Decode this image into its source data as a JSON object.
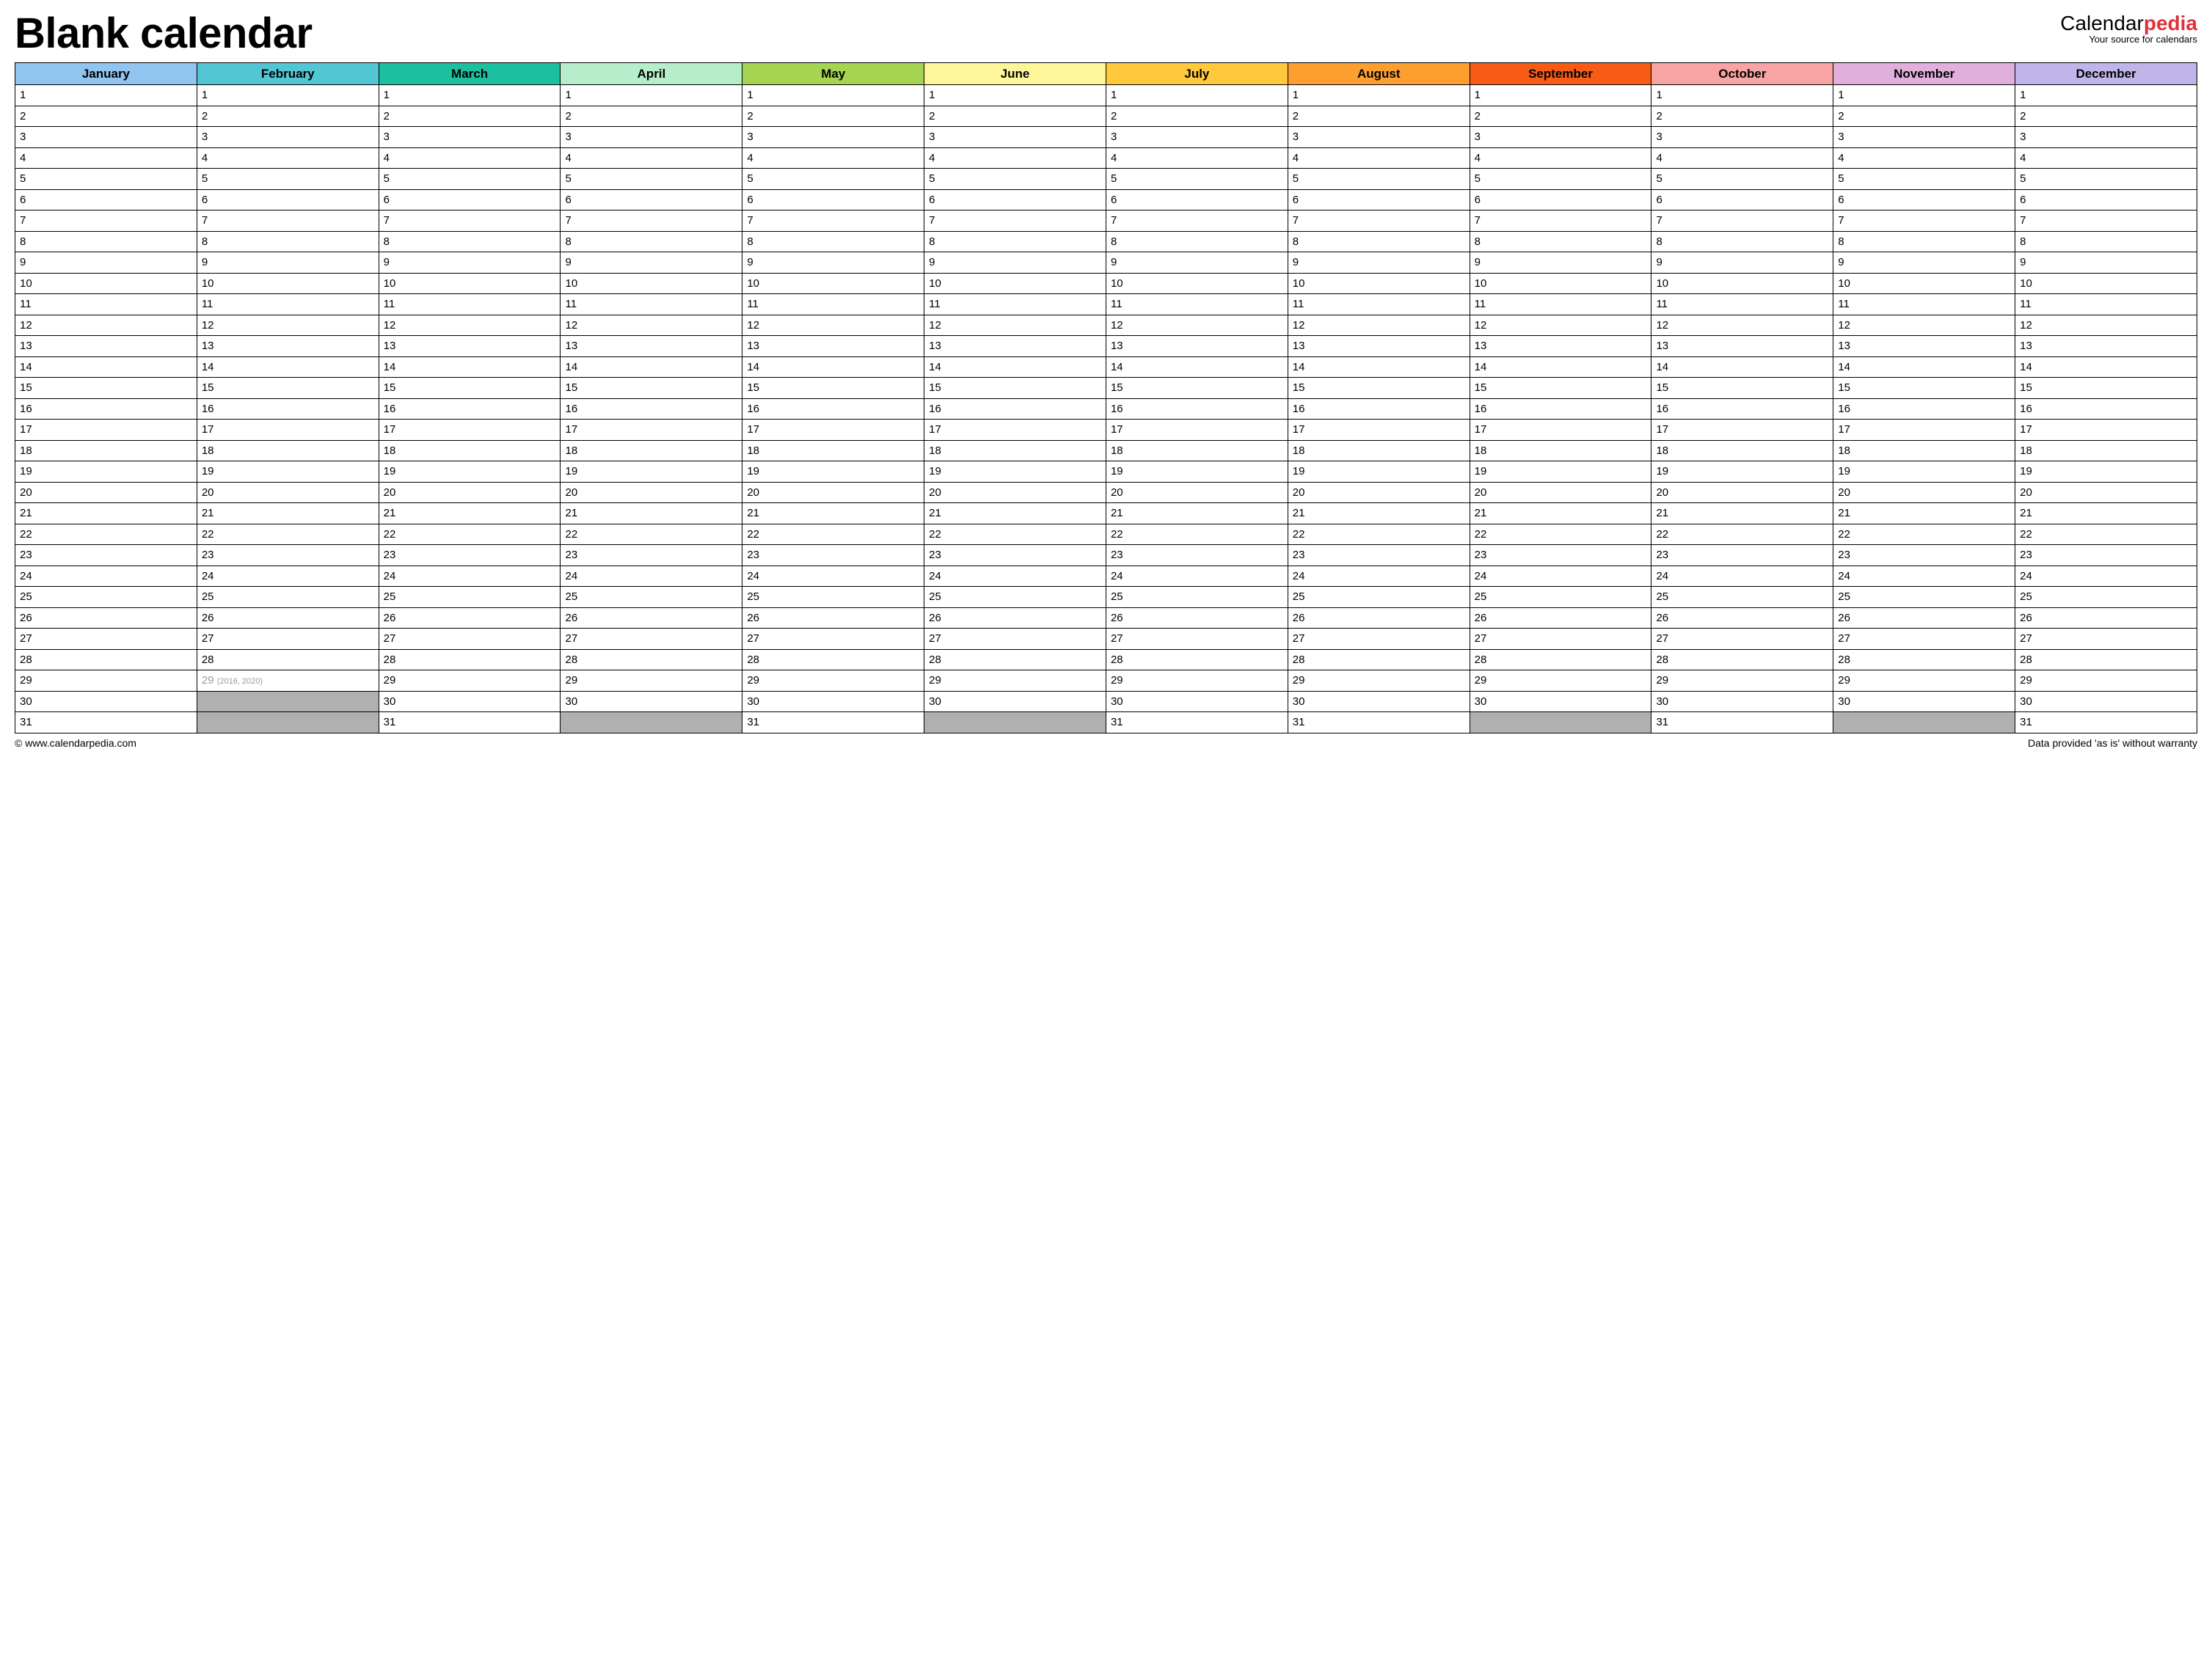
{
  "header": {
    "title": "Blank calendar",
    "brand_cal": "Calendar",
    "brand_pedia": "pedia",
    "brand_sub": "Your source for calendars"
  },
  "months": [
    {
      "name": "January",
      "color": "#92c4f0",
      "days": 31
    },
    {
      "name": "February",
      "color": "#53c6d3",
      "days": 28,
      "leap": {
        "day": 29,
        "note": "(2016, 2020)"
      }
    },
    {
      "name": "March",
      "color": "#1cc0a0",
      "days": 31
    },
    {
      "name": "April",
      "color": "#b6eecb",
      "days": 30
    },
    {
      "name": "May",
      "color": "#a5d452",
      "days": 31
    },
    {
      "name": "June",
      "color": "#fdf79a",
      "days": 30
    },
    {
      "name": "July",
      "color": "#ffc93d",
      "days": 31
    },
    {
      "name": "August",
      "color": "#fd9f30",
      "days": 31
    },
    {
      "name": "September",
      "color": "#f75b15",
      "days": 30
    },
    {
      "name": "October",
      "color": "#f8a4a4",
      "days": 31
    },
    {
      "name": "November",
      "color": "#e1afdc",
      "days": 30
    },
    {
      "name": "December",
      "color": "#c0b5e8",
      "days": 31
    }
  ],
  "max_days": 31,
  "footer": {
    "left": "© www.calendarpedia.com",
    "right": "Data provided 'as is' without warranty"
  }
}
